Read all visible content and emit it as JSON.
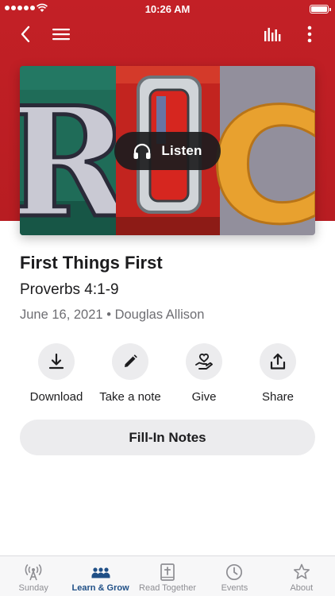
{
  "status_bar": {
    "time": "10:26 AM"
  },
  "header": {
    "background_color": "#c32026",
    "icons": [
      "back-chevron-icon",
      "hamburger-menu-icon",
      "audio-bars-icon",
      "more-vertical-icon"
    ]
  },
  "artwork": {
    "letters": [
      "R",
      "O",
      "C"
    ],
    "listen_label": "Listen",
    "listen_icon": "headphones-icon"
  },
  "sermon": {
    "title": "First Things First",
    "scripture": "Proverbs 4:1-9",
    "date": "June 16, 2021",
    "separator": "•",
    "speaker": "Douglas Allison"
  },
  "actions": [
    {
      "label": "Download",
      "icon": "download-icon"
    },
    {
      "label": "Take a note",
      "icon": "pencil-icon"
    },
    {
      "label": "Give",
      "icon": "heart-hand-icon"
    },
    {
      "label": "Share",
      "icon": "share-icon"
    }
  ],
  "fill_in_notes": {
    "label": "Fill-In Notes"
  },
  "tabbar": {
    "active_color": "#1f4f86",
    "tabs": [
      {
        "label": "Sunday",
        "icon": "broadcast-icon",
        "active": false
      },
      {
        "label": "Learn & Grow",
        "icon": "group-icon",
        "active": true
      },
      {
        "label": "Read Together",
        "icon": "bible-icon",
        "active": false
      },
      {
        "label": "Events",
        "icon": "clock-icon",
        "active": false
      },
      {
        "label": "About",
        "icon": "star-icon",
        "active": false
      }
    ]
  }
}
